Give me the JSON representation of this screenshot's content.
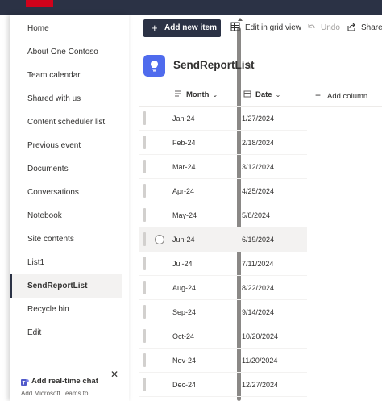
{
  "nav": {
    "items": [
      {
        "label": "Home"
      },
      {
        "label": "About One Contoso"
      },
      {
        "label": "Team calendar"
      },
      {
        "label": "Shared with us"
      },
      {
        "label": "Content scheduler list"
      },
      {
        "label": "Previous event"
      },
      {
        "label": "Documents"
      },
      {
        "label": "Conversations"
      },
      {
        "label": "Notebook"
      },
      {
        "label": "Site contents"
      },
      {
        "label": "List1"
      },
      {
        "label": "SendReportList"
      },
      {
        "label": "Recycle bin"
      },
      {
        "label": "Edit"
      }
    ],
    "active_index": 11
  },
  "promo": {
    "title": "Add real-time chat",
    "subtitle": "Add Microsoft Teams to"
  },
  "command_bar": {
    "new_item": "Add new item",
    "edit_grid": "Edit in grid view",
    "undo": "Undo",
    "share": "Share"
  },
  "list": {
    "title": "SendReportList",
    "columns": {
      "month": "Month",
      "date": "Date",
      "add_column": "Add column"
    },
    "rows": [
      {
        "month": "Jan-24",
        "date": "1/27/2024"
      },
      {
        "month": "Feb-24",
        "date": "2/18/2024"
      },
      {
        "month": "Mar-24",
        "date": "3/12/2024"
      },
      {
        "month": "Apr-24",
        "date": "4/25/2024"
      },
      {
        "month": "May-24",
        "date": "5/8/2024"
      },
      {
        "month": "Jun-24",
        "date": "6/19/2024"
      },
      {
        "month": "Jul-24",
        "date": "7/11/2024"
      },
      {
        "month": "Aug-24",
        "date": "8/22/2024"
      },
      {
        "month": "Sep-24",
        "date": "9/14/2024"
      },
      {
        "month": "Oct-24",
        "date": "10/20/2024"
      },
      {
        "month": "Nov-24",
        "date": "11/20/2024"
      },
      {
        "month": "Dec-24",
        "date": "12/27/2024"
      }
    ],
    "hovered_row_index": 5
  },
  "colors": {
    "suite_bar": "#2b3245",
    "brand_red": "#d0021b",
    "list_icon": "#4f6bed"
  }
}
